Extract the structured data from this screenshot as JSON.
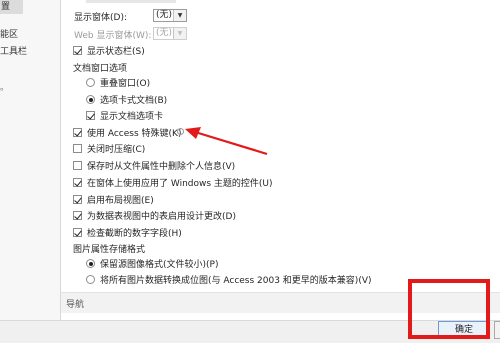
{
  "sidebar": {
    "items": [
      {
        "label": "置"
      },
      {
        "label": "能区"
      },
      {
        "label": "工具栏"
      },
      {
        "label": "。"
      }
    ]
  },
  "options": {
    "display_form": {
      "label": "显示窗体(D):",
      "value": "(无)"
    },
    "web_display_form": {
      "label": "Web 显示窗体(W):",
      "value": "(无)"
    },
    "status_bar": {
      "label": "显示状态栏(S)",
      "checked": true
    },
    "doc_window_group": "文档窗口选项",
    "overlapping_windows": {
      "label": "重叠窗口(O)",
      "checked": false
    },
    "tabbed_documents": {
      "label": "选项卡式文档(B)",
      "checked": true
    },
    "show_doc_tabs": {
      "label": "显示文档选项卡",
      "checked": true
    },
    "access_special_keys": {
      "label": "使用 Access 特殊键(K)",
      "checked": true,
      "info": "i"
    },
    "compact_on_close": {
      "label": "关闭时压缩(C)",
      "checked": false
    },
    "remove_personal_info": {
      "label": "保存时从文件属性中删除个人信息(V)",
      "checked": false
    },
    "windows_themed_controls": {
      "label": "在窗体上使用应用了 Windows 主题的控件(U)",
      "checked": true
    },
    "layout_view": {
      "label": "启用布局视图(E)",
      "checked": true
    },
    "datasheet_design_changes": {
      "label": "为数据表视图中的表启用设计更改(D)",
      "checked": true
    },
    "truncated_number_fields": {
      "label": "检查截断的数字字段(H)",
      "checked": true
    },
    "picture_format_group": "图片属性存储格式",
    "preserve_source_format": {
      "label": "保留源图像格式(文件较小)(P)",
      "checked": true
    },
    "convert_to_bitmap": {
      "label": "将所有图片数据转换成位图(与 Access 2003 和更早的版本兼容)(V)",
      "checked": false
    }
  },
  "navigation": {
    "label": "导航"
  },
  "footer": {
    "ok_label": "确定"
  },
  "colors": {
    "annotation_red": "#e21a1a"
  }
}
